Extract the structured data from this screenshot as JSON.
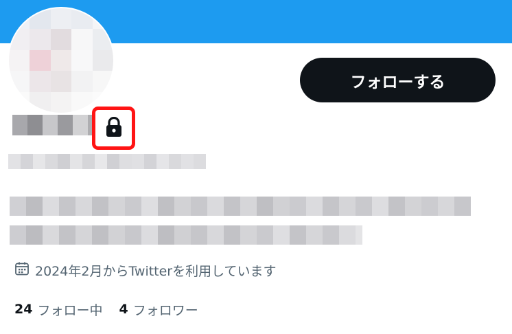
{
  "header": {
    "banner_color": "#1d9bf0"
  },
  "profile": {
    "avatar_icon": "pixelated-avatar",
    "lock_icon": "lock-icon",
    "follow_button_label": "フォローする",
    "joined_icon": "calendar-icon",
    "joined_text": "2024年2月からTwitterを利用しています"
  },
  "stats": {
    "following_count": "24",
    "following_label": "フォロー中",
    "followers_count": "4",
    "followers_label": "フォロワー"
  },
  "colors": {
    "accent": "#1d9bf0",
    "button_bg": "#0f1419",
    "highlight_border": "#ff1414",
    "secondary_text": "#536471"
  }
}
